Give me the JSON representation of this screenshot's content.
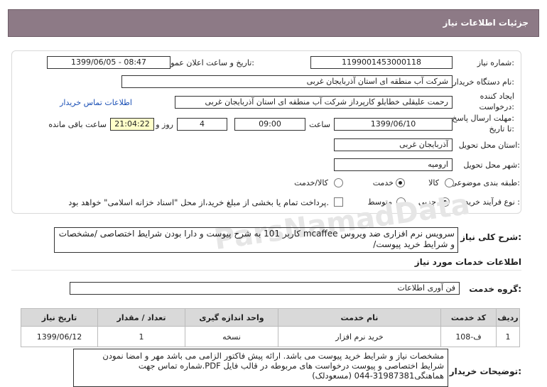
{
  "header": {
    "title": "جزئیات اطلاعات نیاز"
  },
  "fields": {
    "need_number_label": "شماره نیاز:",
    "need_number": "1199001453000118",
    "announce_label": "تاریخ و ساعت اعلان عمومی:",
    "announce_value": "1399/06/05 - 08:47",
    "buyer_label": "نام دستگاه خریدار:",
    "buyer_value": "شرکت آب منطقه ای استان آذربایجان غربی",
    "creator_label_1": "ایجاد کننده",
    "creator_label_2": "درخواست:",
    "creator_value": "رحمت علیقلی خطایلو کارپرداز شرکت آب منطقه ای استان آذربایجان غربی",
    "contact_link": "اطلاعات تماس خریدار",
    "deadline_label_1": "مهلت ارسال پاسخ:",
    "deadline_label_2": "تا تاریخ:",
    "deadline_date": "1399/06/10",
    "time_label": "ساعت",
    "deadline_time": "09:00",
    "days_value": "4",
    "days_label": "روز و",
    "remaining_time": "21:04:22",
    "remaining_label": "ساعت باقی مانده",
    "province_label": "استان محل تحویل:",
    "province_value": "آذربایجان غربی",
    "city_label": "شهر محل تحویل:",
    "city_value": "ارومیه",
    "category_label": "طبقه بندی موضوعی:",
    "category_options": [
      "کالا",
      "خدمت",
      "کالا/خدمت"
    ],
    "category_selected": "خدمت",
    "process_label": "نوع فرآیند خرید :",
    "process_options": [
      "جزیی",
      "متوسط"
    ],
    "process_selected": "جزیی",
    "payment_note": "پرداخت تمام یا بخشی از مبلغ خرید،از محل \"اسناد خزانه اسلامی\" خواهد بود."
  },
  "description": {
    "label": "شرح کلی نیاز:",
    "value": "سرویس نرم افزاری ضد ویروس mcaffee کاربر 101 به شرح پیوست و دارا بودن شرایط اختصاصی /مشخصات و شرایط خرید پیوست/"
  },
  "services": {
    "section_title": "اطلاعات خدمات مورد نیاز",
    "group_label": "گروه خدمت:",
    "group_value": "فن آوری اطلاعات",
    "columns": [
      "ردیف",
      "کد خدمت",
      "نام خدمت",
      "واحد اندازه گیری",
      "تعداد / مقدار",
      "تاریخ نیاز"
    ],
    "rows": [
      {
        "row": "1",
        "code": "ف-108",
        "name": "خرید نرم افزار",
        "unit": "نسخه",
        "qty": "1",
        "date": "1399/06/12"
      }
    ]
  },
  "buyer_notes": {
    "label": "توضیحات خریدار:",
    "value": "مشخصات نیاز و شرایط خرید پیوست می باشد. ارائه پیش فاکتور الزامی می باشد مهر و امضا نمودن شرایط اختصاصی و پیوست درخواست های مربوطه در قالب فایل PDF.شماره تماس جهت هماهنگی31987381-044 (مسعودلک)"
  },
  "watermark": "ParsNamadData"
}
